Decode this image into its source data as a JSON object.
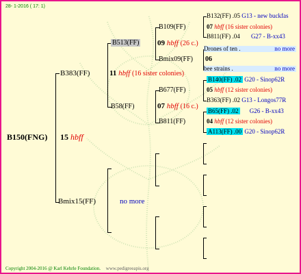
{
  "header": {
    "date": "28- 1-2016 ( 17: 1)"
  },
  "root": {
    "name": "B150(FNG)",
    "num": "15",
    "hbff": "hbff"
  },
  "l1": {
    "top": {
      "name": "B383(FF)",
      "num": "11",
      "hbff": "hbff",
      "note": "(16 sister colonies)"
    },
    "bottom": {
      "name": "Bmix15(FF)",
      "more": "no more"
    }
  },
  "l2": {
    "a": {
      "name": "B513(FF)",
      "num": "09",
      "hbff": "hbff",
      "note": "(26 c.)"
    },
    "b": {
      "name": "B58(FF)",
      "num": "07",
      "hbff": "hbff",
      "note": "(16 c.)"
    }
  },
  "l3": {
    "a1": {
      "name": "B109(FF)"
    },
    "a2": {
      "name": "Bmix09(FF)",
      "num": "06"
    },
    "b1": {
      "name": "B677(FF)",
      "num": "05",
      "hbff": "hbff",
      "note": "(12 sister colonies)"
    },
    "b2": {
      "name": "B811(FF)",
      "num": "04",
      "hbff": "hbff",
      "note": "(12 sister colonies)"
    }
  },
  "l4": {
    "r1": {
      "name": "B132(FF)",
      "num": ".05",
      "origin": "G13 - new buckfas"
    },
    "r2": {
      "num": "07",
      "hbff": "hbff",
      "note": "(16 sister colonies)"
    },
    "r3": {
      "name": "B811(FF)",
      "num": ".04",
      "origin": "G27 - B-xx43"
    },
    "r4": {
      "name": "Drones of ten .",
      "more": "no more"
    },
    "r5": {
      "name": "bee strains .",
      "more": "no more"
    },
    "r6": {
      "name": "B140(FF)",
      "num": ".02",
      "origin": "G20 - Sinop62R"
    },
    "r7": {
      "num": "05",
      "hbff": "hbff",
      "note": "(12 sister colonies)"
    },
    "r8": {
      "name": "B363(FF)",
      "num": ".02",
      "origin": "G13 - Longos77R"
    },
    "r9": {
      "name": "B65(FF)",
      "num": ".02",
      "origin": "G26 - B-xx43"
    },
    "r10": {
      "num": "04",
      "hbff": "hbff",
      "note": "(12 sister colonies)"
    },
    "r11": {
      "name": "A113(FF)",
      "num": ".00",
      "origin": "G20 - Sinop62R"
    }
  },
  "footer": {
    "copyright": "Copyright 2004-2016 @ Karl Kehrle Foundation.",
    "url": "www.pedigreeapis.org"
  }
}
